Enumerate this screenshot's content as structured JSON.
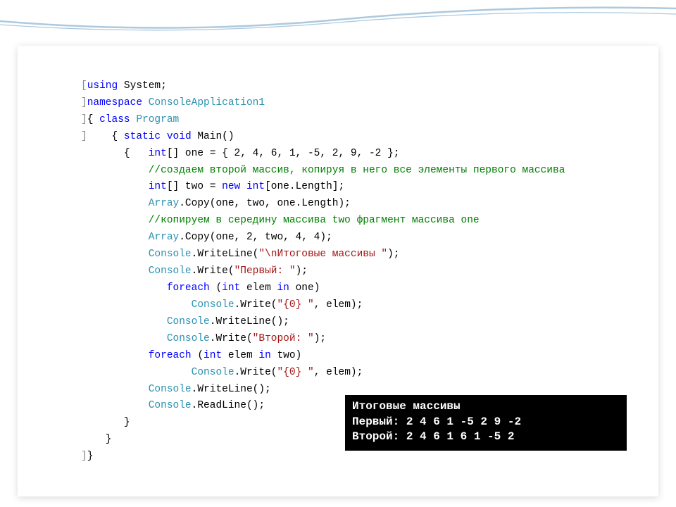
{
  "code": {
    "l01a": "using",
    "l01b": " System;",
    "l02a": "namespace",
    "l02b": " ConsoleApplication1",
    "l03a": "{ ",
    "l03b": "class",
    "l03c": " Program",
    "l04a": "    { ",
    "l04b": "static",
    "l04c": " void",
    "l04d": " Main()",
    "l05a": "       {   ",
    "l05b": "int",
    "l05c": "[] one = { 2, 4, 6, 1, -5, 2, 9, -2 };",
    "l06": "           //создаем второй массив, копируя в него все элементы первого массива",
    "l07a": "           ",
    "l07b": "int",
    "l07c": "[] two = ",
    "l07d": "new",
    "l07e": " int",
    "l07f": "[one.Length];",
    "l08a": "           ",
    "l08b": "Array",
    "l08c": ".Copy(one, two, one.Length);",
    "l09": "           //копируем в середину массива two фрагмент массива one",
    "l10a": "           ",
    "l10b": "Array",
    "l10c": ".Copy(one, 2, two, 4, 4);",
    "l11a": "           ",
    "l11b": "Console",
    "l11c": ".WriteLine(",
    "l11d": "\"\\nИтоговые массивы \"",
    "l11e": ");",
    "l12a": "           ",
    "l12b": "Console",
    "l12c": ".Write(",
    "l12d": "\"Первый: \"",
    "l12e": ");",
    "l13a": "              ",
    "l13b": "foreach",
    "l13c": " (",
    "l13d": "int",
    "l13e": " elem ",
    "l13f": "in",
    "l13g": " one)",
    "l14a": "                  ",
    "l14b": "Console",
    "l14c": ".Write(",
    "l14d": "\"{0} \"",
    "l14e": ", elem);",
    "l15a": "              ",
    "l15b": "Console",
    "l15c": ".WriteLine();",
    "l16a": "              ",
    "l16b": "Console",
    "l16c": ".Write(",
    "l16d": "\"Второй: \"",
    "l16e": ");",
    "l17a": "           ",
    "l17b": "foreach",
    "l17c": " (",
    "l17d": "int",
    "l17e": " elem ",
    "l17f": "in",
    "l17g": " two)",
    "l18a": "                  ",
    "l18b": "Console",
    "l18c": ".Write(",
    "l18d": "\"{0} \"",
    "l18e": ", elem);",
    "l19a": "           ",
    "l19b": "Console",
    "l19c": ".WriteLine();",
    "l20a": "           ",
    "l20b": "Console",
    "l20c": ".ReadLine();",
    "l21": "       }",
    "l22": "    }",
    "l23": "}",
    "collapse_open": "[",
    "collapse_end": "]"
  },
  "console": {
    "line1": "Итоговые массивы",
    "line2": "Первый: 2 4 6 1 -5 2 9 -2",
    "line3": "Второй: 2 4 6 1 6 1 -5 2"
  }
}
